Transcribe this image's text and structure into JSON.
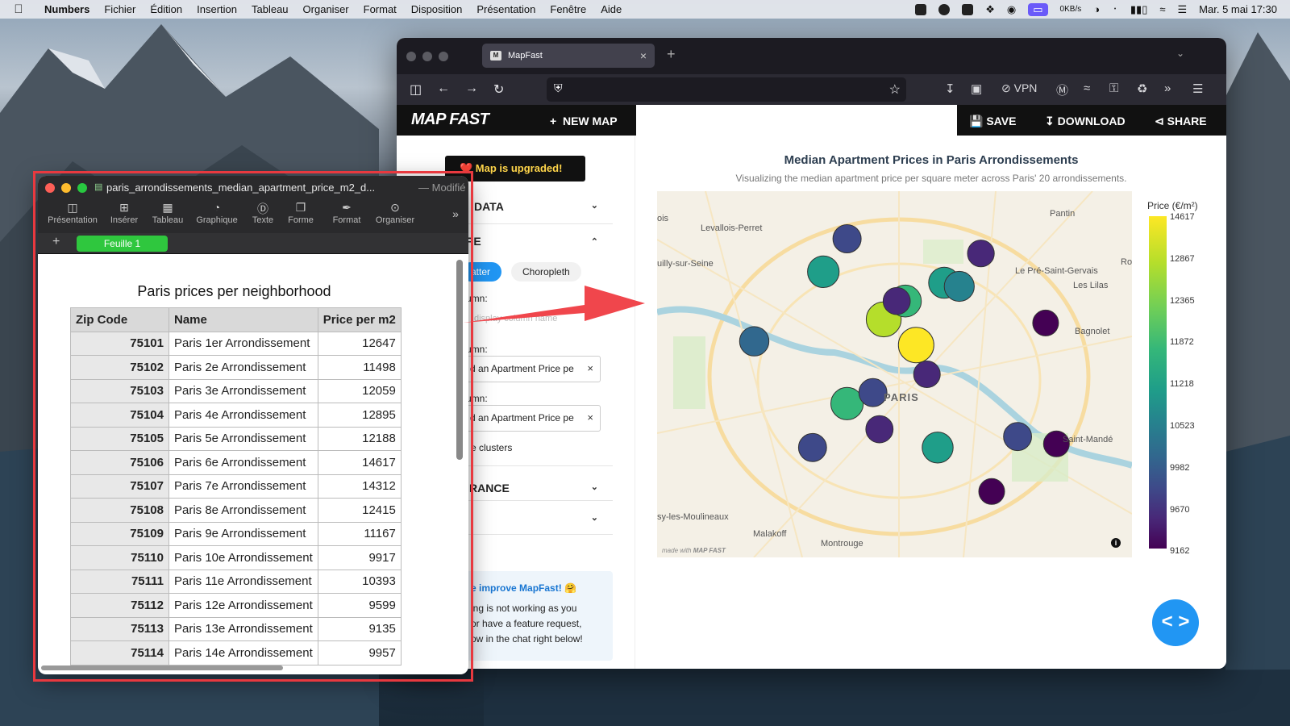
{
  "menubar": {
    "app": "Numbers",
    "items": [
      "Fichier",
      "Édition",
      "Insertion",
      "Tableau",
      "Organiser",
      "Format",
      "Disposition",
      "Présentation",
      "Fenêtre",
      "Aide"
    ],
    "net": "0KB/s",
    "clock": "Mar. 5 mai 17:30"
  },
  "browser": {
    "tab_title": "MapFast",
    "vpn_label": "VPN"
  },
  "mapfast": {
    "logo": "MAP FAST",
    "new_map": "NEW MAP",
    "save": "SAVE",
    "download": "DOWNLOAD",
    "share": "SHARE",
    "upgraded": "❤️ Map is upgraded!",
    "sections": [
      "DATA",
      "TYPE",
      "APPEARANCE",
      ""
    ],
    "sections_visible": [
      "DATA",
      "PE",
      "RANCE",
      ""
    ],
    "type_options": [
      "Scatter",
      "Choropleth"
    ],
    "type_options_visible": [
      "atter",
      "Choropleth"
    ],
    "field_labels_visible": [
      "umn:",
      "umn:",
      "umn:"
    ],
    "select_placeholder_visible": "display column name",
    "select_1_visible": "d an Apartment Price pe",
    "select_2_visible": "d an Apartment Price pe",
    "clusters_visible": "e clusters",
    "improve_title_visible": "e improve MapFast! 🤗",
    "improve_lines_visible": [
      "ing is not working as you",
      "or have a feature request,",
      "ow in the chat right below!"
    ],
    "code_button": "< >"
  },
  "map": {
    "title": "Median Apartment Prices in Paris Arrondissements",
    "subtitle": "Visualizing the median apartment price per square meter across Paris' 20 arrondissements.",
    "cities": [
      "Levallois-Perret",
      "uilly-sur-Seine",
      "Pantin",
      "Le Pré-Saint-Gervais",
      "Les Lilas",
      "Bagnolet",
      "Saint-Mandé",
      "Malakoff",
      "Montrouge",
      "sy-les-Moulineaux",
      "ois",
      "Ro"
    ],
    "center_label": "PARIS",
    "made_with": "made with",
    "made_with_brand": "MAP FAST",
    "colorbar_title": "Price (€/m²)",
    "colorbar_ticks": [
      "14617",
      "12867",
      "12365",
      "11872",
      "11218",
      "10523",
      "9982",
      "9670",
      "9162"
    ],
    "colors": {
      "high": "#fde725",
      "mid": "#21918c",
      "low": "#440154"
    }
  },
  "chart_data": {
    "type": "scatter",
    "title": "Median Apartment Prices in Paris Arrondissements",
    "colorbar": "Price (€/m²)",
    "clim": [
      9162,
      14617
    ],
    "points": [
      {
        "lon": 2.345,
        "lat": 48.873,
        "value": 14617
      },
      {
        "lon": 2.33,
        "lat": 48.88,
        "value": 14312
      },
      {
        "lon": 2.313,
        "lat": 48.857,
        "value": 12895
      },
      {
        "lon": 2.34,
        "lat": 48.885,
        "value": 12647
      },
      {
        "lon": 2.302,
        "lat": 48.893,
        "value": 12415
      },
      {
        "lon": 2.358,
        "lat": 48.89,
        "value": 12188
      },
      {
        "lon": 2.355,
        "lat": 48.845,
        "value": 12059
      },
      {
        "lon": 2.365,
        "lat": 48.889,
        "value": 11498
      },
      {
        "lon": 2.27,
        "lat": 48.874,
        "value": 11167
      },
      {
        "lon": 2.297,
        "lat": 48.845,
        "value": 10393
      },
      {
        "lon": 2.325,
        "lat": 48.86,
        "value": 10393
      },
      {
        "lon": 2.392,
        "lat": 48.848,
        "value": 10393
      },
      {
        "lon": 2.313,
        "lat": 48.902,
        "value": 10523
      },
      {
        "lon": 2.336,
        "lat": 48.885,
        "value": 9917
      },
      {
        "lon": 2.328,
        "lat": 48.85,
        "value": 9957
      },
      {
        "lon": 2.35,
        "lat": 48.865,
        "value": 9599
      },
      {
        "lon": 2.375,
        "lat": 48.898,
        "value": 9670
      },
      {
        "lon": 2.405,
        "lat": 48.879,
        "value": 9162
      },
      {
        "lon": 2.41,
        "lat": 48.846,
        "value": 9162
      },
      {
        "lon": 2.38,
        "lat": 48.833,
        "value": 9135
      }
    ]
  },
  "numbers": {
    "filename": "paris_arrondissements_median_apartment_price_m2_d...",
    "modified": "— Modifié",
    "toolbar": [
      "Présentation",
      "Insérer",
      "Tableau",
      "Graphique",
      "Texte",
      "Forme",
      "Format",
      "Organiser"
    ],
    "sheet": "Feuille 1",
    "table_title": "Paris prices per neighborhood",
    "columns": [
      "Zip Code",
      "Name",
      "Price per m2"
    ],
    "rows": [
      [
        "75101",
        "Paris 1er Arrondissement",
        "12647"
      ],
      [
        "75102",
        "Paris 2e Arrondissement",
        "11498"
      ],
      [
        "75103",
        "Paris 3e Arrondissement",
        "12059"
      ],
      [
        "75104",
        "Paris 4e Arrondissement",
        "12895"
      ],
      [
        "75105",
        "Paris 5e Arrondissement",
        "12188"
      ],
      [
        "75106",
        "Paris 6e Arrondissement",
        "14617"
      ],
      [
        "75107",
        "Paris 7e Arrondissement",
        "14312"
      ],
      [
        "75108",
        "Paris 8e Arrondissement",
        "12415"
      ],
      [
        "75109",
        "Paris 9e Arrondissement",
        "11167"
      ],
      [
        "75110",
        "Paris 10e Arrondissement",
        "9917"
      ],
      [
        "75111",
        "Paris 11e Arrondissement",
        "10393"
      ],
      [
        "75112",
        "Paris 12e Arrondissement",
        "9599"
      ],
      [
        "75113",
        "Paris 13e Arrondissement",
        "9135"
      ],
      [
        "75114",
        "Paris 14e Arrondissement",
        "9957"
      ]
    ]
  }
}
